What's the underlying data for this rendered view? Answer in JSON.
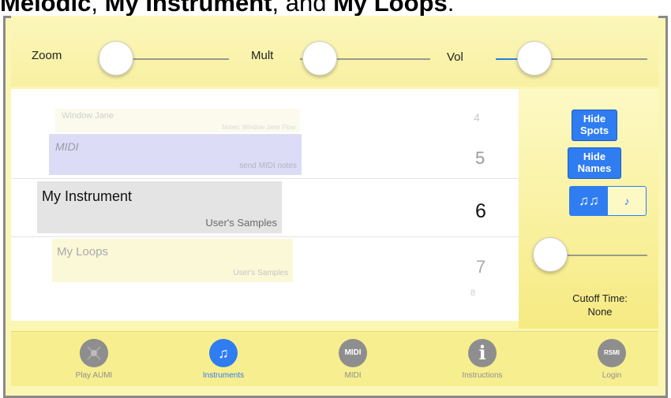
{
  "caption": {
    "part1": "Melodic",
    "part2": ", ",
    "part3": "My Instrument",
    "part4": ", and ",
    "part5": "My Loops",
    "part6": "."
  },
  "sliders": {
    "zoom_label": "Zoom",
    "mult_label": "Mult",
    "vol_label": "Vol"
  },
  "picker": {
    "items": [
      {
        "name": "Window Jane",
        "sub": "Notes: Window Jane Flow",
        "number": "4"
      },
      {
        "name": "MIDI",
        "sub": "send MIDI notes",
        "number": "5"
      },
      {
        "name": "My Instrument",
        "sub": "User's Samples",
        "number": "6"
      },
      {
        "name": "My Loops",
        "sub": "User's Samples",
        "number": "7"
      },
      {
        "name": "",
        "sub": "",
        "number": "8"
      }
    ]
  },
  "panel": {
    "hide_spots": "Hide Spots",
    "hide_names": "Hide Names",
    "seg_left": "♫♫",
    "seg_right": "♪",
    "cutoff_label": "Cutoff Time:",
    "cutoff_value": "None"
  },
  "tabs": [
    {
      "label": "Play AUMI",
      "icon": "play-disc-icon",
      "glyph": ""
    },
    {
      "label": "Instruments",
      "icon": "music-note-icon",
      "glyph": "♫",
      "active": true
    },
    {
      "label": "MIDI",
      "icon": "midi-icon",
      "glyph": "MIDI"
    },
    {
      "label": "Instructions",
      "icon": "info-icon",
      "glyph": "i"
    },
    {
      "label": "Login",
      "icon": "login-icon",
      "glyph": "RSMI"
    }
  ],
  "colors": {
    "accent": "#2f7df0",
    "background": "#fbf6b4",
    "picker_bg": "#ffffff"
  }
}
